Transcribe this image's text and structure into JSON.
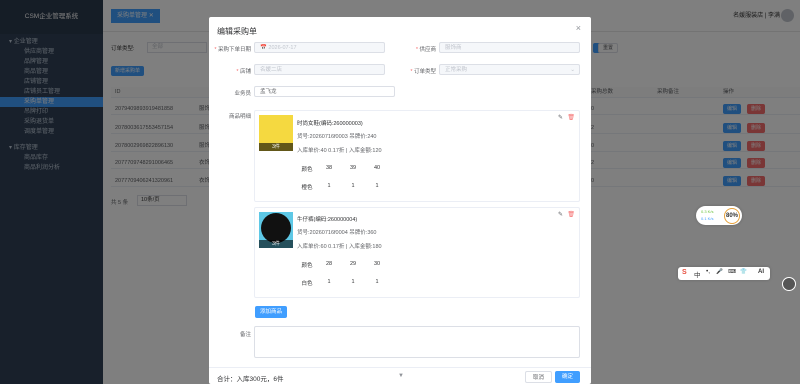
{
  "app": {
    "title": "CSM企业管理系统"
  },
  "sidebar": {
    "groups": [
      {
        "label": "企业管理",
        "items": [
          "供应商管理",
          "品牌管理",
          "商品管理",
          "店铺管理",
          "店铺员工管理",
          "采购单管理",
          "吊牌打印",
          "采购退货单",
          "调度单管理"
        ]
      },
      {
        "label": "库存管理",
        "items": [
          "商品库存",
          "商品利润分析"
        ]
      }
    ]
  },
  "topbar": {
    "tab_label": "采购单管理",
    "tab_close": "✕",
    "user_label": "名媛服装店 | 李满"
  },
  "background": {
    "filter_label": "订单类型:",
    "filter_placeholder": "全部",
    "add_button": "新增采购单",
    "reset_button": "重置",
    "col_id": "ID",
    "col_total": "采购总数",
    "col_note": "采购备注",
    "col_action": "操作",
    "rows": [
      "2079409893919481858",
      "2078003617553457154",
      "2078002969822896130",
      "2077709748291006465",
      "2077709406241320961"
    ],
    "row_cells": [
      "服饰",
      "服饰",
      "服饰",
      "衣饰",
      "衣饰"
    ],
    "row_totals": [
      "0",
      "2",
      "0",
      "2",
      "0"
    ],
    "edit_label": "编辑",
    "delete_label": "删除",
    "pagination": "共 5 条",
    "page_size": "10条/页"
  },
  "dialog": {
    "title": "编辑采购单",
    "close": "×",
    "order_date_label": "采购下单日期",
    "order_date_value": "2026-07-17",
    "supplier_label": "供应商",
    "supplier_value": "服饰商",
    "store_label": "店铺",
    "store_value": "名媛二店",
    "order_type_label": "订单类型",
    "order_type_value": "正常采购",
    "salesperson_label": "业务员",
    "salesperson_value": "孟飞龙",
    "details_label": "商品明细",
    "products": [
      {
        "name": "时尚女鞋(编码:260000003)",
        "code_line": "货号:20260716f0003 吊牌价:240",
        "price_line": "入库单价:40 0.17折 | 入库金额:120",
        "qty": "3件",
        "color_header": "颜色",
        "sizes": [
          "38",
          "39",
          "40"
        ],
        "rows": [
          {
            "color": "橙色",
            "q": [
              "1",
              "1",
              "1"
            ]
          }
        ],
        "thumb_color": "#f5d940"
      },
      {
        "name": "牛仔裤(编码:260000004)",
        "code_line": "货号:20260716f0004 吊牌价:360",
        "price_line": "入库单价:60 0.17折 | 入库金额:180",
        "qty": "3件",
        "color_header": "颜色",
        "sizes": [
          "28",
          "29",
          "30"
        ],
        "rows": [
          {
            "color": "白色",
            "q": [
              "1",
              "1",
              "1"
            ]
          }
        ],
        "thumb_color": "#5ec8e6"
      }
    ],
    "add_product_button": "添加商品",
    "note_label": "备注",
    "total_text": "合计：入库300元，6件",
    "cancel_button": "取消",
    "confirm_button": "确定"
  },
  "widget": {
    "percent": "80%",
    "line1": "0.3 K/s",
    "line2": "0.1 K/s"
  },
  "ime": {
    "glyphs": [
      "S",
      "中",
      "•,",
      "🎤",
      "⌨",
      "👕",
      "A"
    ],
    "ai": "AI"
  }
}
